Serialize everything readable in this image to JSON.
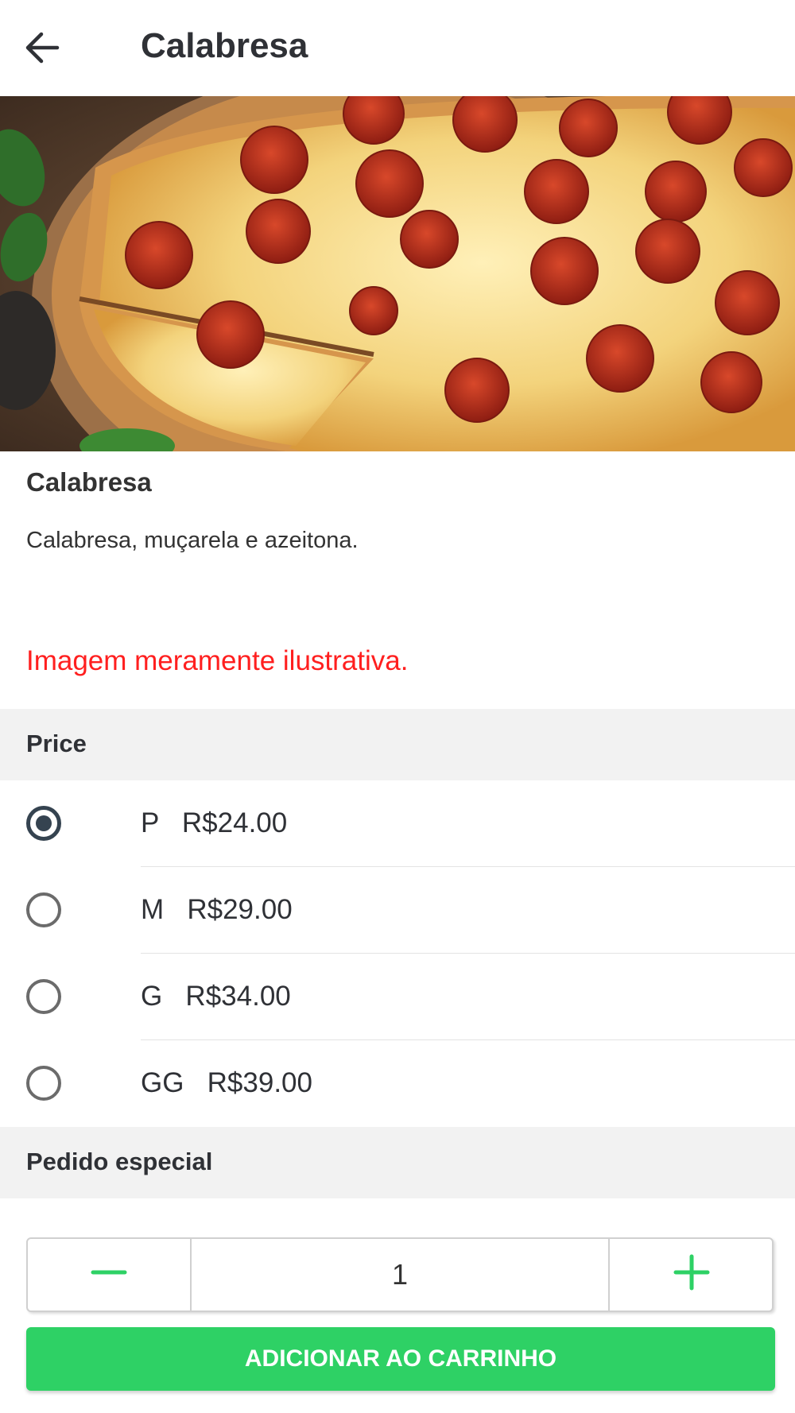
{
  "header": {
    "title": "Calabresa",
    "back_icon": "arrow-left-icon"
  },
  "product": {
    "name": "Calabresa",
    "description": "Calabresa, muçarela e azeitona.",
    "disclaimer": "Imagem meramente ilustrativa.",
    "image_subject": "pepperoni-pizza-photo"
  },
  "price_section": {
    "title": "Price",
    "options": [
      {
        "size": "P",
        "price": "R$24.00",
        "selected": true
      },
      {
        "size": "M",
        "price": "R$29.00",
        "selected": false
      },
      {
        "size": "G",
        "price": "R$34.00",
        "selected": false
      },
      {
        "size": "GG",
        "price": "R$39.00",
        "selected": false
      }
    ]
  },
  "special_section": {
    "title": "Pedido especial"
  },
  "quantity": {
    "value": "1",
    "minus_icon": "minus-icon",
    "plus_icon": "plus-icon"
  },
  "add_button": {
    "label": "ADICIONAR AO CARRINHO"
  },
  "colors": {
    "accent": "#2ed165",
    "disclaimer": "#ff1f1f",
    "radio_selected": "#354350",
    "section_bg": "#f2f2f2"
  }
}
